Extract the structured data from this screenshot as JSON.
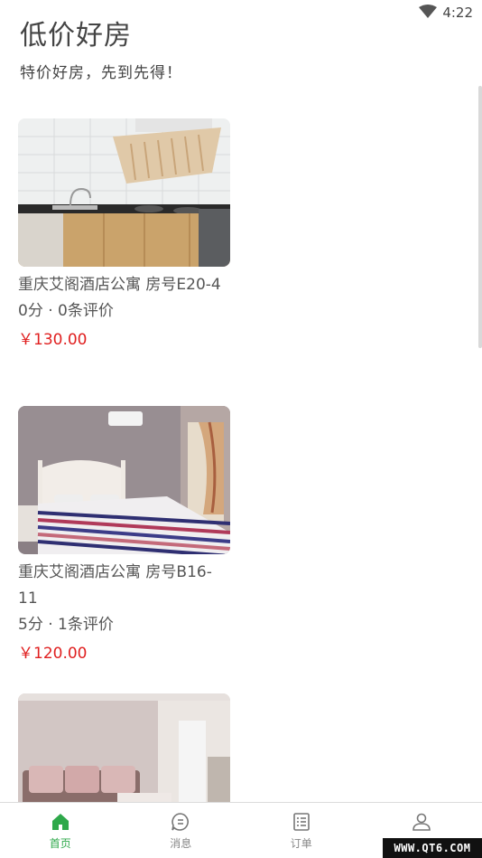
{
  "status_bar": {
    "time": "4:22"
  },
  "header": {
    "title": "低价好房",
    "subtitle": "特价好房，先到先得！"
  },
  "listings": [
    {
      "name": "重庆艾阁酒店公寓 房号E20-4",
      "rating": "0分 · 0条评价",
      "price": "￥130.00",
      "photo": "kitchen"
    },
    {
      "name": "重庆艾阁酒店公寓 房号B16-11",
      "rating": "5分 · 1条评价",
      "price": "￥120.00",
      "photo": "bedroom"
    },
    {
      "photo": "living-room"
    }
  ],
  "bottom_nav": [
    {
      "label": "首页",
      "icon": "home-icon",
      "active": true
    },
    {
      "label": "消息",
      "icon": "message-icon",
      "active": false
    },
    {
      "label": "订单",
      "icon": "order-list-icon",
      "active": false
    },
    {
      "label": "",
      "icon": "user-icon",
      "active": false
    }
  ],
  "watermark": "WWW.QT6.COM",
  "colors": {
    "accent": "#2ea84a",
    "price": "#e02020"
  }
}
